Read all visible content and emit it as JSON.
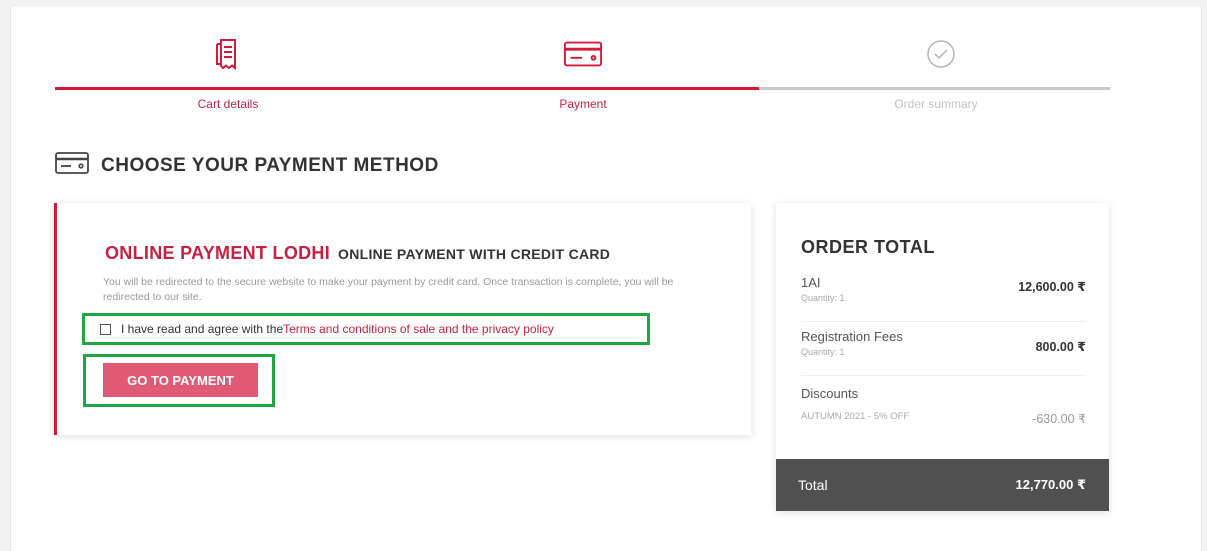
{
  "stepper": {
    "steps": [
      {
        "label": "Cart details",
        "icon": "receipt-icon",
        "state": "done"
      },
      {
        "label": "Payment",
        "icon": "credit-card-icon",
        "state": "active"
      },
      {
        "label": "Order summary",
        "icon": "check-circle-icon",
        "state": "pending"
      }
    ]
  },
  "section": {
    "title": "CHOOSE YOUR PAYMENT METHOD",
    "icon": "credit-card-icon"
  },
  "payment": {
    "brand": "ONLINE PAYMENT LODHI",
    "subtitle": "ONLINE PAYMENT WITH CREDIT CARD",
    "description": "You will be redirected to the secure website to make your payment by credit card. Once transaction is complete, you will be redirected to our site.",
    "terms_text": "I have read and agree with the ",
    "terms_link": "Terms and conditions of sale and the privacy policy",
    "terms_checked": false,
    "button_label": "GO TO PAYMENT"
  },
  "order": {
    "title": "ORDER TOTAL",
    "items": [
      {
        "name": "1AI",
        "quantity": "Quantity: 1",
        "price": "12,600.00 ₹"
      },
      {
        "name": "Registration Fees",
        "quantity": "Quantity: 1",
        "price": "800.00 ₹"
      }
    ],
    "discount": {
      "name": "Discounts",
      "code": "AUTUMN 2021 - 5% OFF",
      "amount": "-630.00 ₹"
    },
    "total_label": "Total",
    "total_value": "12,770.00 ₹"
  },
  "colors": {
    "accent": "#d7183a",
    "button": "#e05a76",
    "highlight": "#1fa542",
    "total_bar": "#505050"
  }
}
